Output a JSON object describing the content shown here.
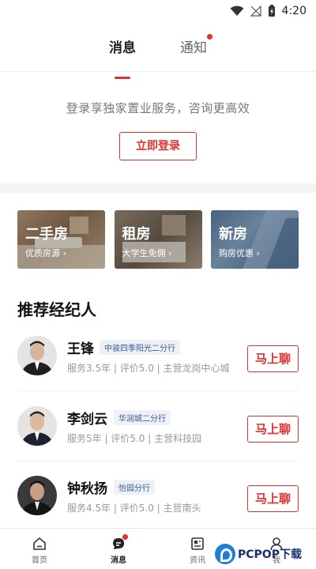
{
  "status_bar": {
    "time": "4:20"
  },
  "tabs": [
    {
      "label": "消息",
      "active": true
    },
    {
      "label": "通知",
      "active": false,
      "badge": true
    }
  ],
  "login": {
    "tip": "登录享独家置业服务，咨询更高效",
    "button": "立即登录"
  },
  "cards": [
    {
      "title": "二手房",
      "subtitle": "优质房源"
    },
    {
      "title": "租房",
      "subtitle": "大学生免佣"
    },
    {
      "title": "新房",
      "subtitle": "购房优惠"
    }
  ],
  "section_title": "推荐经纪人",
  "agents": [
    {
      "name": "王锋",
      "branch": "中骏四季阳光二分行",
      "info": "服务3.5年 | 评价5.0 | 主营龙岗中心城",
      "chat": "马上聊"
    },
    {
      "name": "李剑云",
      "branch": "华润城二分行",
      "info": "服务5年 | 评价5.0 | 主营科技园",
      "chat": "马上聊"
    },
    {
      "name": "钟秋扬",
      "branch": "怡园分行",
      "info": "服务4.5年 | 评价5.0 | 主营南头",
      "chat": "马上聊"
    }
  ],
  "tabbar": [
    {
      "label": "首页",
      "icon": "home-icon"
    },
    {
      "label": "消息",
      "icon": "message-icon",
      "active": true,
      "badge": true
    },
    {
      "label": "资讯",
      "icon": "news-icon"
    },
    {
      "label": "我",
      "icon": "user-icon"
    }
  ],
  "watermark": {
    "text": "PCPOP下载"
  },
  "colors": {
    "accent": "#e0312e",
    "branch_text": "#3d5a8a"
  }
}
